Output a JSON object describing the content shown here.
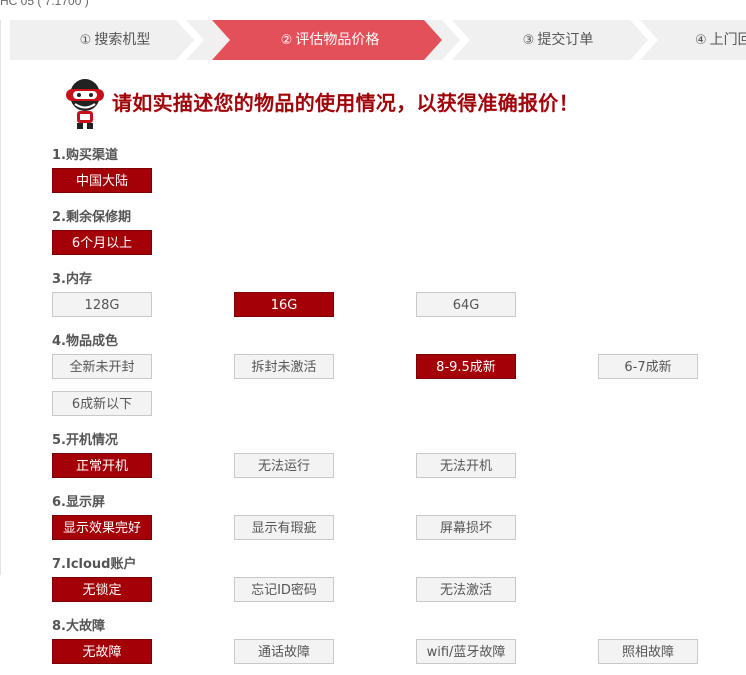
{
  "top_text": "HC 05 ( 7.1700 )",
  "steps": [
    {
      "num": "①",
      "label": "搜索机型"
    },
    {
      "num": "②",
      "label": "评估物品价格",
      "active": true
    },
    {
      "num": "③",
      "label": "提交订单"
    },
    {
      "num": "④",
      "label": "上门回"
    }
  ],
  "headline": "请如实描述您的物品的使用情况，以获得准确报价！",
  "questions": [
    {
      "title": "1.购买渠道",
      "options": [
        {
          "label": "中国大陆",
          "selected": true
        }
      ]
    },
    {
      "title": "2.剩余保修期",
      "options": [
        {
          "label": "6个月以上",
          "selected": true
        }
      ]
    },
    {
      "title": "3.内存",
      "options": [
        {
          "label": "128G"
        },
        {
          "label": "16G",
          "selected": true
        },
        {
          "label": "64G"
        }
      ]
    },
    {
      "title": "4.物品成色",
      "options": [
        {
          "label": "全新未开封"
        },
        {
          "label": "拆封未激活"
        },
        {
          "label": "8-9.5成新",
          "selected": true
        },
        {
          "label": "6-7成新"
        },
        {
          "label": "6成新以下"
        }
      ]
    },
    {
      "title": "5.开机情况",
      "options": [
        {
          "label": "正常开机",
          "selected": true
        },
        {
          "label": "无法运行"
        },
        {
          "label": "无法开机"
        }
      ]
    },
    {
      "title": "6.显示屏",
      "options": [
        {
          "label": "显示效果完好",
          "selected": true
        },
        {
          "label": "显示有瑕疵"
        },
        {
          "label": "屏幕损坏"
        }
      ]
    },
    {
      "title": "7.Icloud账户",
      "options": [
        {
          "label": "无锁定",
          "selected": true
        },
        {
          "label": "忘记ID密码"
        },
        {
          "label": "无法激活"
        }
      ]
    },
    {
      "title": "8.大故障",
      "options": [
        {
          "label": "无故障",
          "selected": true
        },
        {
          "label": "通话故障"
        },
        {
          "label": "wifi/蓝牙故障"
        },
        {
          "label": "照相故障"
        }
      ]
    }
  ],
  "colors": {
    "accent": "#e4505a",
    "selected": "#a30008",
    "headline": "#a0040a"
  }
}
